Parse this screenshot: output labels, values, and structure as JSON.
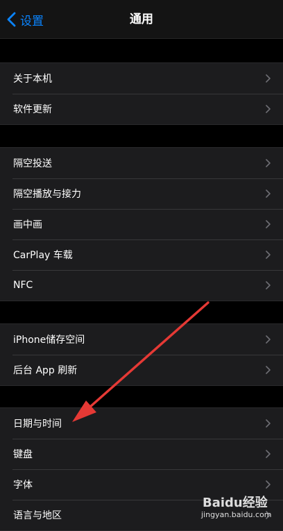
{
  "navbar": {
    "back_label": "设置",
    "title": "通用"
  },
  "groups": [
    {
      "items": [
        {
          "label": "关于本机"
        },
        {
          "label": "软件更新"
        }
      ]
    },
    {
      "items": [
        {
          "label": "隔空投送"
        },
        {
          "label": "隔空播放与接力"
        },
        {
          "label": "画中画"
        },
        {
          "label": "CarPlay 车载"
        },
        {
          "label": "NFC"
        }
      ]
    },
    {
      "items": [
        {
          "label": "iPhone储存空间"
        },
        {
          "label": "后台 App 刷新"
        }
      ]
    },
    {
      "items": [
        {
          "label": "日期与时间"
        },
        {
          "label": "键盘"
        },
        {
          "label": "字体"
        },
        {
          "label": "语言与地区"
        }
      ]
    }
  ],
  "annotation": {
    "arrow_color": "#e53935",
    "points_to": "日期与时间"
  },
  "watermark": {
    "logo_text": "Baidu经验",
    "url": "jingyan.baidu.com"
  },
  "colors": {
    "accent": "#0a84ff",
    "background": "#000000",
    "cell": "#1c1c1e",
    "chevron": "#6e6e73"
  }
}
